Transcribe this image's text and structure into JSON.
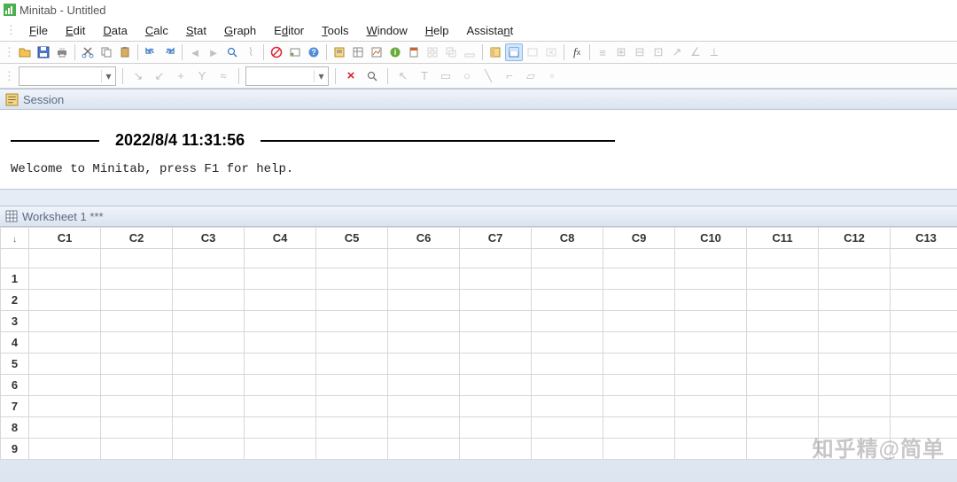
{
  "window": {
    "title": "Minitab - Untitled"
  },
  "menu": {
    "file": "File",
    "edit": "Edit",
    "data": "Data",
    "calc": "Calc",
    "stat": "Stat",
    "graph": "Graph",
    "editor": "Editor",
    "tools": "Tools",
    "window": "Window",
    "help": "Help",
    "assistant": "Assistant"
  },
  "session": {
    "title": "Session",
    "timestamp": "2022/8/4 11:31:56",
    "welcome": "Welcome to Minitab, press F1 for help."
  },
  "worksheet": {
    "title": "Worksheet 1 ***",
    "columns": [
      "C1",
      "C2",
      "C3",
      "C4",
      "C5",
      "C6",
      "C7",
      "C8",
      "C9",
      "C10",
      "C11",
      "C12",
      "C13"
    ],
    "rows": [
      1,
      2,
      3,
      4,
      5,
      6,
      7,
      8,
      9
    ]
  },
  "secondbar": {
    "close_label": "×"
  },
  "watermark": "知乎精@简单"
}
